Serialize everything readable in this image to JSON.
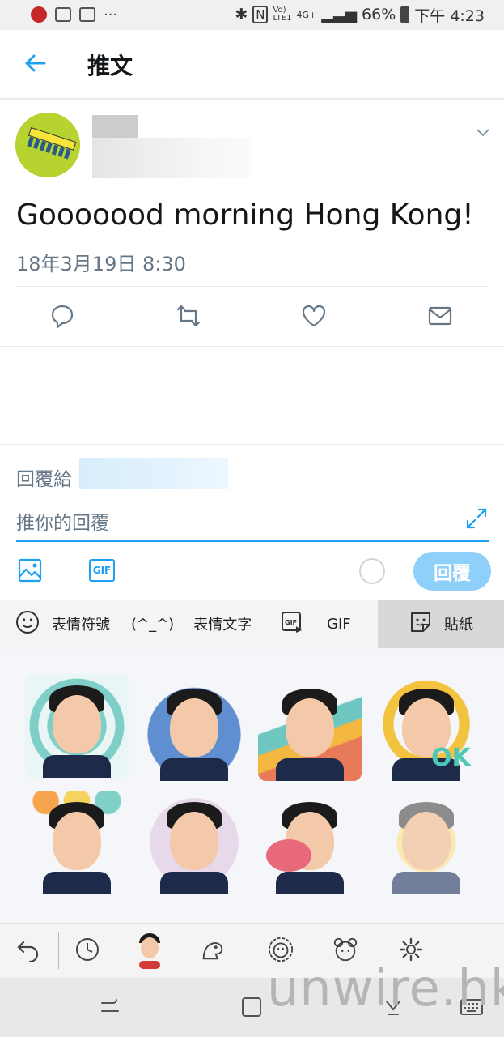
{
  "status_bar": {
    "battery": "66%",
    "time": "下午 4:23",
    "more": "···",
    "network": "4G+"
  },
  "header": {
    "title": "推文"
  },
  "tweet": {
    "text": "Gooooood morning Hong Kong!",
    "date": "18年3月19日 8:30"
  },
  "reply": {
    "reply_to_label": "回覆給",
    "placeholder": "推你的回覆",
    "gif_label": "GIF",
    "button_label": "回覆"
  },
  "keyboard": {
    "tabs": [
      {
        "label": "表情符號",
        "icon": "smiley-icon"
      },
      {
        "label": "表情文字",
        "icon_text": "(^_^)"
      },
      {
        "label": "GIF",
        "icon": "gif-icon"
      },
      {
        "label": "貼紙",
        "icon": "sticker-icon",
        "active": true
      }
    ],
    "sticker_badge": "OK"
  },
  "watermark": "unwire.hk",
  "colors": {
    "accent": "#1da1f2",
    "reply_button": "#8ed0f9",
    "text_secondary": "#657786"
  }
}
